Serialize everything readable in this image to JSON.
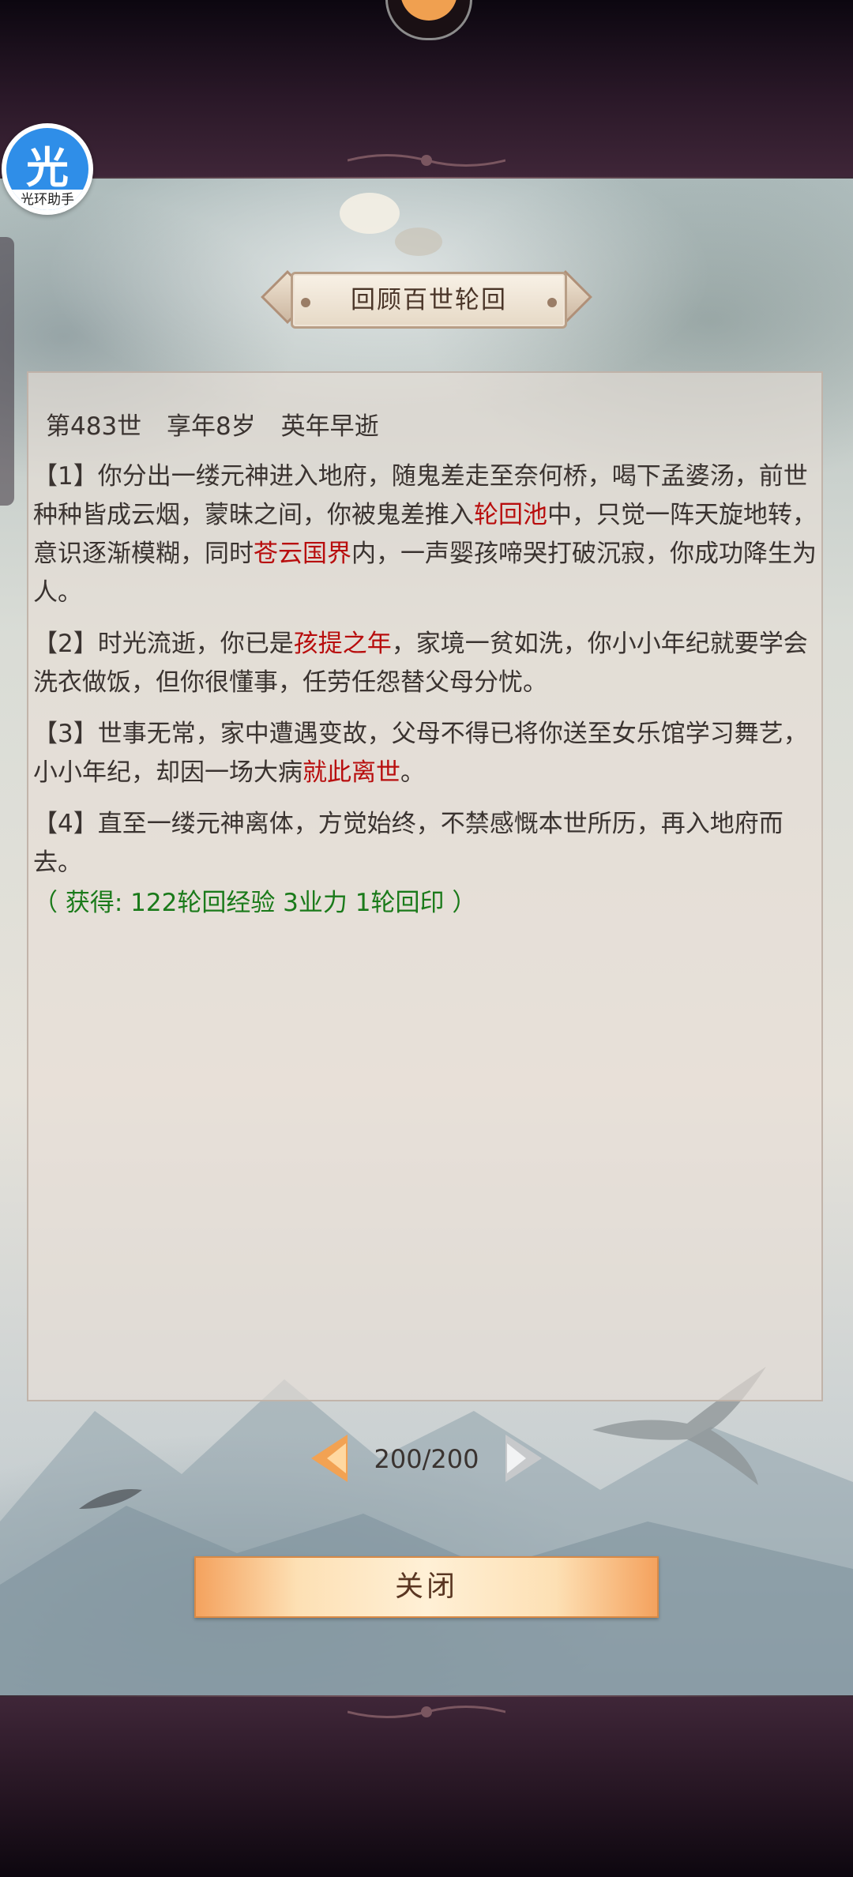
{
  "assistant_badge": {
    "glyph": "光",
    "label": "光环助手"
  },
  "dialog": {
    "title": "回顾百世轮回",
    "life_header": {
      "life": "第483世",
      "age": "享年8岁",
      "fate": "英年早逝"
    },
    "paragraphs": [
      {
        "number": "【1】",
        "segments": [
          {
            "text": "你分出一缕元神进入地府，随鬼差走至奈何桥，喝下孟婆汤，前世种种皆成云烟，蒙昧之间，你被鬼差推入",
            "highlight": false
          },
          {
            "text": "轮回池",
            "highlight": true
          },
          {
            "text": "中，只觉一阵天旋地转，意识逐渐模糊，同时",
            "highlight": false
          },
          {
            "text": "苍云国界",
            "highlight": true
          },
          {
            "text": "内，一声婴孩啼哭打破沉寂，你成功降生为人。",
            "highlight": false
          }
        ]
      },
      {
        "number": "【2】",
        "segments": [
          {
            "text": "时光流逝，你已是",
            "highlight": false
          },
          {
            "text": "孩提之年",
            "highlight": true
          },
          {
            "text": "，家境一贫如洗，你小小年纪就要学会洗衣做饭，但你很懂事，任劳任怨替父母分忧。",
            "highlight": false
          }
        ]
      },
      {
        "number": "【3】",
        "segments": [
          {
            "text": "世事无常，家中遭遇变故，父母不得已将你送至女乐馆学习舞艺，小小年纪，却因一场大病",
            "highlight": false
          },
          {
            "text": "就此离世",
            "highlight": true
          },
          {
            "text": "。",
            "highlight": false
          }
        ]
      },
      {
        "number": "【4】",
        "segments": [
          {
            "text": "直至一缕元神离体，方觉始终，不禁感慨本世所历，再入地府而去。",
            "highlight": false
          }
        ]
      }
    ],
    "reward": "（ 获得: 122轮回经验 3业力 1轮回印 ）",
    "pagination": {
      "current": 200,
      "total": 200,
      "text": "200/200"
    },
    "close_label": "关闭"
  },
  "colors": {
    "highlight": "#b80d0d",
    "reward": "#1a7a1a",
    "body_text": "#3a3330",
    "button_accent": "#f4a25e"
  }
}
